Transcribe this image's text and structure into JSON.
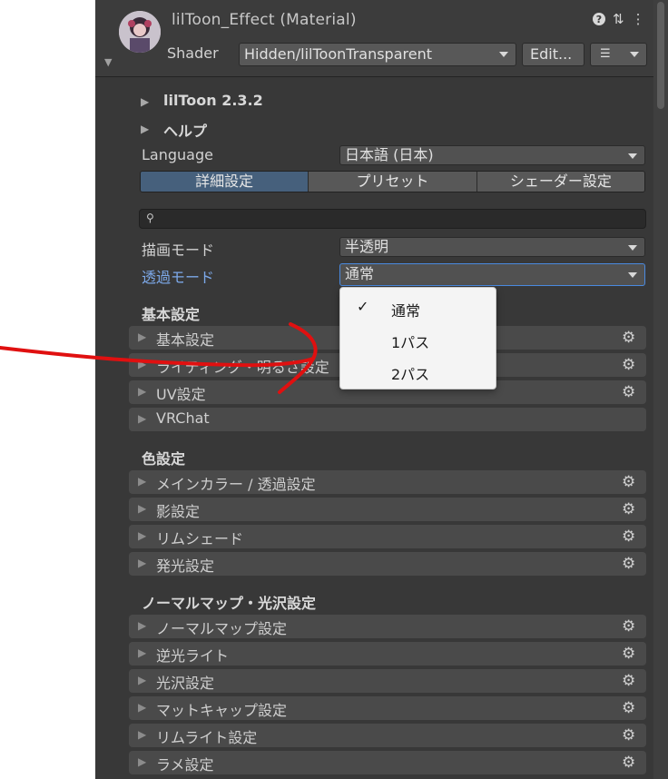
{
  "header": {
    "title": "lilToon_Effect (Material)",
    "shader_label": "Shader",
    "shader_value": "Hidden/lilToonTransparent",
    "edit_label": "Edit...",
    "list_icon": "list-icon"
  },
  "folds": {
    "version": "lilToon 2.3.2",
    "help": "ヘルプ"
  },
  "language": {
    "label": "Language",
    "value": "日本語 (日本)"
  },
  "tabs": [
    {
      "label": "詳細設定",
      "active": true
    },
    {
      "label": "プリセット",
      "active": false
    },
    {
      "label": "シェーダー設定",
      "active": false
    }
  ],
  "render_mode": {
    "label": "描画モード",
    "value": "半透明"
  },
  "transparent_mode": {
    "label": "透過モード",
    "value": "通常"
  },
  "dropdown_options": [
    {
      "label": "通常",
      "checked": true
    },
    {
      "label": "1パス",
      "checked": false
    },
    {
      "label": "2パス",
      "checked": false
    }
  ],
  "sections": {
    "basic": {
      "title": "基本設定",
      "items": [
        "基本設定",
        "ライティング・明るさ設定",
        "UV設定",
        "VRChat"
      ]
    },
    "color": {
      "title": "色設定",
      "items": [
        "メインカラー / 透過設定",
        "影設定",
        "リムシェード",
        "発光設定"
      ]
    },
    "normal": {
      "title": "ノーマルマップ・光沢設定",
      "items": [
        "ノーマルマップ設定",
        "逆光ライト",
        "光沢設定",
        "マットキャップ設定",
        "リムライト設定",
        "ラメ設定"
      ]
    }
  },
  "colors": {
    "panel_bg": "#383838",
    "active_tab": "#46607c",
    "highlight_label": "#7ca8e8",
    "annotation_red": "#e01010"
  }
}
